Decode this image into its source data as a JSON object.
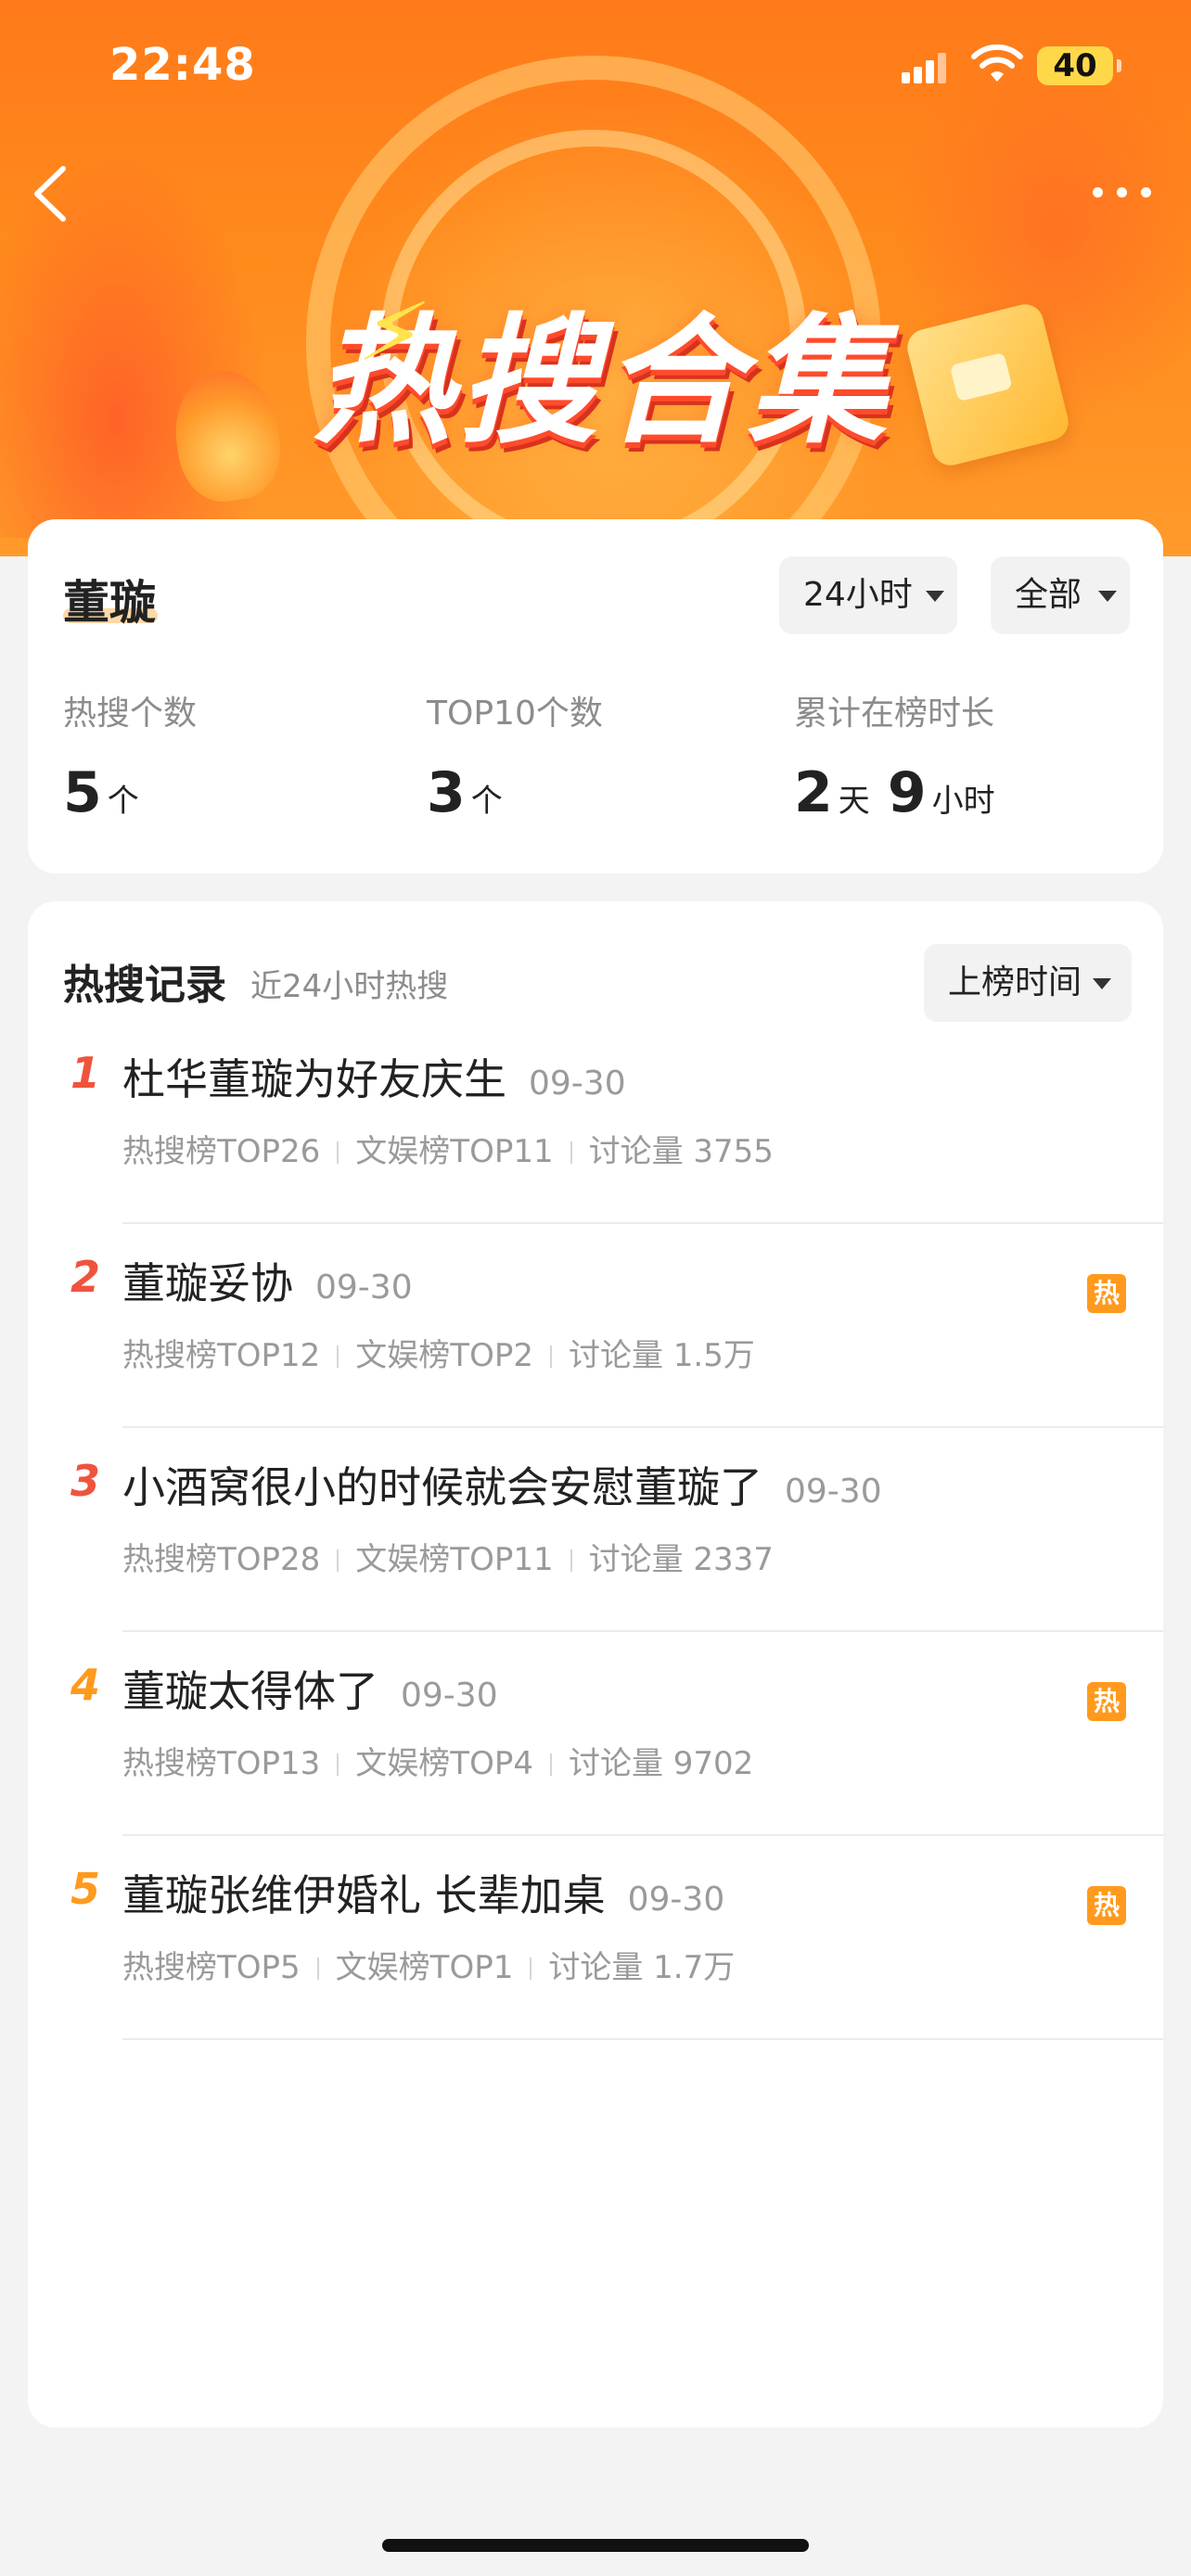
{
  "status_bar": {
    "time": "22:48",
    "battery": "40"
  },
  "banner": {
    "title": "热搜合集"
  },
  "summary": {
    "name": "董璇",
    "filter_time": "24小时",
    "filter_scope": "全部",
    "stats": [
      {
        "label": "热搜个数",
        "value": "5",
        "unit": "个"
      },
      {
        "label": "TOP10个数",
        "value": "3",
        "unit": "个"
      },
      {
        "label": "累计在榜时长",
        "days": "2",
        "days_unit": "天",
        "hours": "9",
        "hours_unit": "小时"
      }
    ]
  },
  "records": {
    "title": "热搜记录",
    "subtitle": "近24小时热搜",
    "sort_label": "上榜时间",
    "hot_badge": "热",
    "items": [
      {
        "rank": "1",
        "title": "杜华董璇为好友庆生",
        "date": "09-30",
        "board1": "热搜榜TOP26",
        "board2": "文娱榜TOP11",
        "discussion": "讨论量 3755",
        "hot": false
      },
      {
        "rank": "2",
        "title": "董璇妥协",
        "date": "09-30",
        "board1": "热搜榜TOP12",
        "board2": "文娱榜TOP2",
        "discussion": "讨论量 1.5万",
        "hot": true
      },
      {
        "rank": "3",
        "title": "小酒窝很小的时候就会安慰董璇了",
        "date": "09-30",
        "board1": "热搜榜TOP28",
        "board2": "文娱榜TOP11",
        "discussion": "讨论量 2337",
        "hot": false
      },
      {
        "rank": "4",
        "title": "董璇太得体了",
        "date": "09-30",
        "board1": "热搜榜TOP13",
        "board2": "文娱榜TOP4",
        "discussion": "讨论量 9702",
        "hot": true
      },
      {
        "rank": "5",
        "title": "董璇张维伊婚礼 长辈加桌",
        "date": "09-30",
        "board1": "热搜榜TOP5",
        "board2": "文娱榜TOP1",
        "discussion": "讨论量 1.7万",
        "hot": true
      }
    ]
  },
  "colors": {
    "accent_orange": "#ff9a1e",
    "rank_red": "#f0533d",
    "banner": "#ff8a1c"
  }
}
